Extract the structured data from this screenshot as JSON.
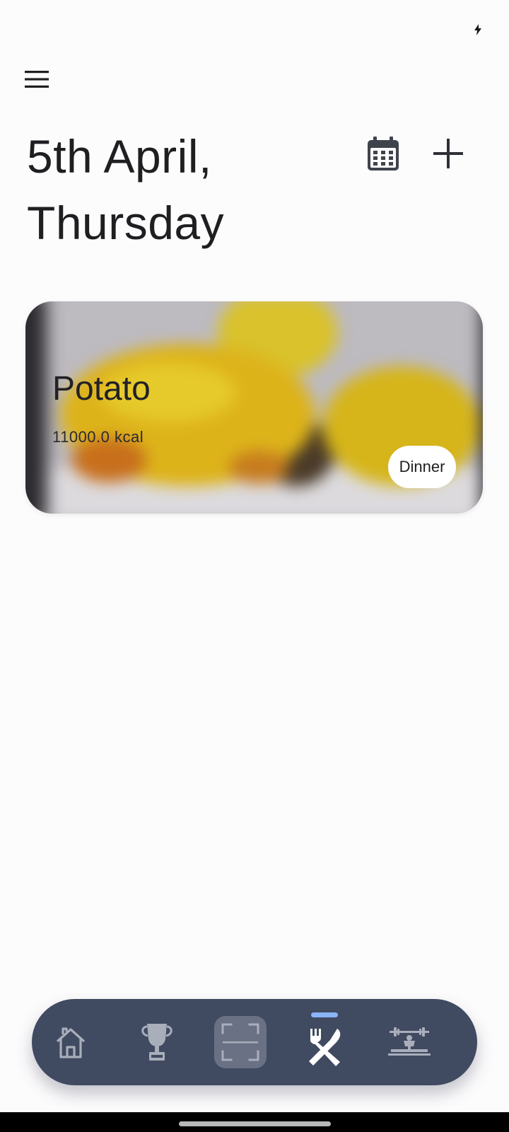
{
  "status_bar": {
    "icons": [
      "charging-bolt-icon"
    ]
  },
  "header": {
    "menu_icon": "hamburger-menu-icon",
    "title_line1": "5th April,",
    "title_line2": "Thursday",
    "calendar_icon": "calendar-icon",
    "add_icon": "plus-icon"
  },
  "meals": [
    {
      "name": "Potato",
      "calories": "11000.0 kcal",
      "meal_type": "Dinner"
    }
  ],
  "bottom_nav": {
    "items": [
      {
        "icon": "home-icon",
        "active": false
      },
      {
        "icon": "trophy-icon",
        "active": false
      },
      {
        "icon": "scan-icon",
        "active": false
      },
      {
        "icon": "fork-knife-icon",
        "active": true
      },
      {
        "icon": "workout-bench-icon",
        "active": false
      }
    ],
    "colors": {
      "background": "#404a60",
      "active_indicator": "#8ab4f8",
      "icon_inactive": "#a9aebb",
      "icon_active": "#ffffff"
    }
  }
}
